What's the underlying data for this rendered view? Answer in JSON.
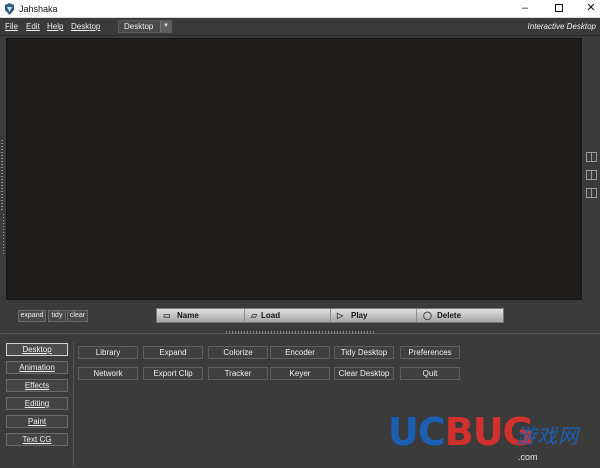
{
  "window": {
    "title": "Jahshaka",
    "controls": {
      "minimize": "–",
      "close": "✕"
    }
  },
  "menubar": {
    "items": [
      "File",
      "Edit",
      "Help",
      "Desktop"
    ],
    "desktop_select": {
      "value": "Desktop",
      "arrow": "▼"
    },
    "mode_label": "Interactive Desktop"
  },
  "controls": {
    "expand": "expand",
    "tidy": "tidy",
    "clear": "clear"
  },
  "clip_bar": [
    {
      "label": "Name",
      "icon": "name-icon"
    },
    {
      "label": "Load",
      "icon": "load-icon"
    },
    {
      "label": "Play",
      "icon": "play-icon"
    },
    {
      "label": "Delete",
      "icon": "delete-icon"
    }
  ],
  "side_tabs": [
    "Desktop",
    "Animation",
    "Effects",
    "Editing",
    "Paint",
    "Text CG"
  ],
  "active_tab": "Desktop",
  "grid_buttons": {
    "row1": [
      "Library",
      "Expand",
      "Colorize",
      "Encoder",
      "Tidy Desktop",
      "Preferences"
    ],
    "row2": [
      "Network",
      "Export Clip",
      "Tracker",
      "Keyer",
      "Clear Desktop",
      "Quit"
    ]
  },
  "watermark": {
    "brand_uc": "UC",
    "brand_bug": "BUG",
    "brand_cn": "游戏网",
    "url": ".com",
    "colors": {
      "uc": "#1a5fb4",
      "bug": "#d0312d",
      "cn": "#1a5fb4"
    }
  },
  "colors": {
    "viewport": "#1f1d1b",
    "panel": "#3b3b3b",
    "clip_bar": "#c8c8c8"
  }
}
